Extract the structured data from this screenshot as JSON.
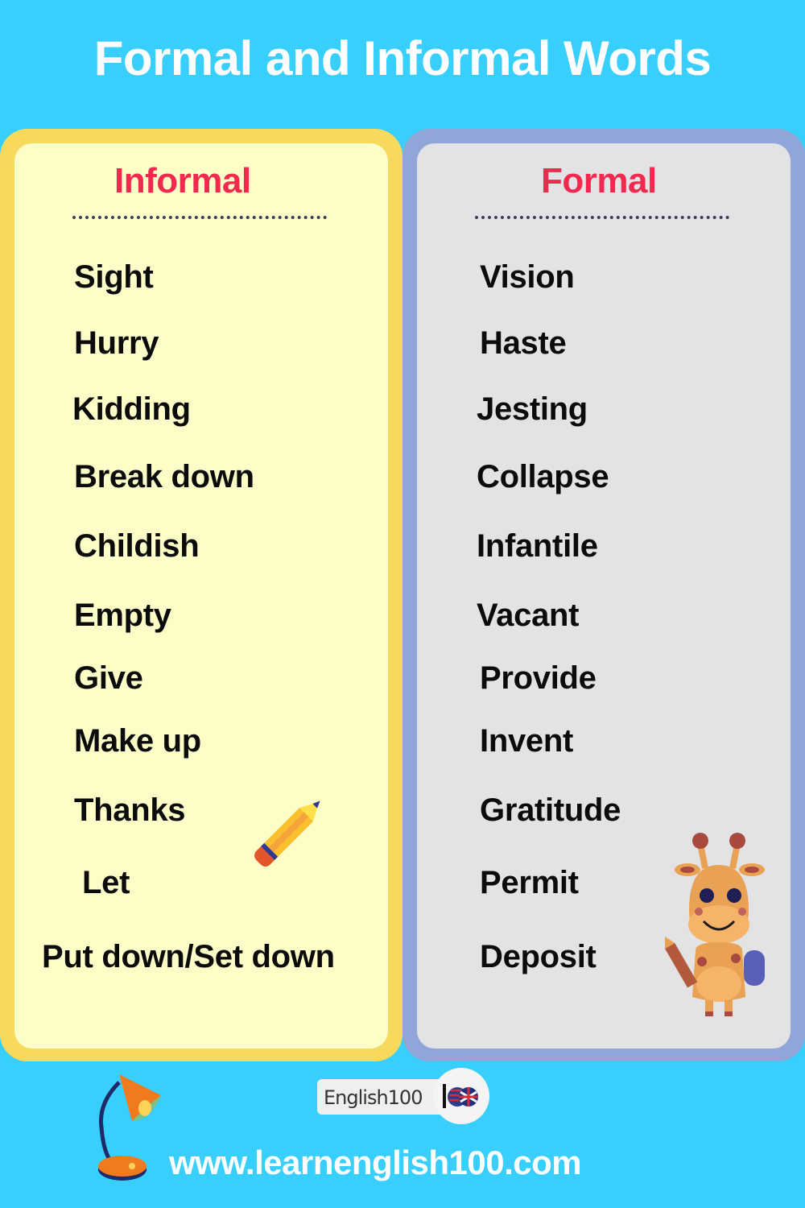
{
  "title": "Formal and Informal Words",
  "columns": {
    "informal": {
      "heading": "Informal",
      "words": [
        "Sight",
        "Hurry",
        "Kidding",
        "Break down",
        "Childish",
        "Empty",
        "Give",
        "Make up",
        "Thanks",
        "Let",
        "Put down/Set down"
      ]
    },
    "formal": {
      "heading": "Formal",
      "words": [
        "Vision",
        "Haste",
        "Jesting",
        "Collapse",
        "Infantile",
        "Vacant",
        "Provide",
        "Invent",
        "Gratitude",
        "Permit",
        "Deposit"
      ]
    }
  },
  "footer": {
    "logo_text": "English100",
    "logo_badge": "100",
    "url": "www.learnenglish100.com"
  },
  "colors": {
    "background": "#38cffc",
    "heading_accent": "#f0294f",
    "informal_border": "#f7d95e",
    "informal_fill": "#fdfdc8",
    "formal_border": "#92a5d8",
    "formal_fill": "#e3e3e5"
  },
  "icons": [
    "pencil-icon",
    "giraffe-icon",
    "desk-lamp-icon",
    "flag-badge-icon"
  ]
}
